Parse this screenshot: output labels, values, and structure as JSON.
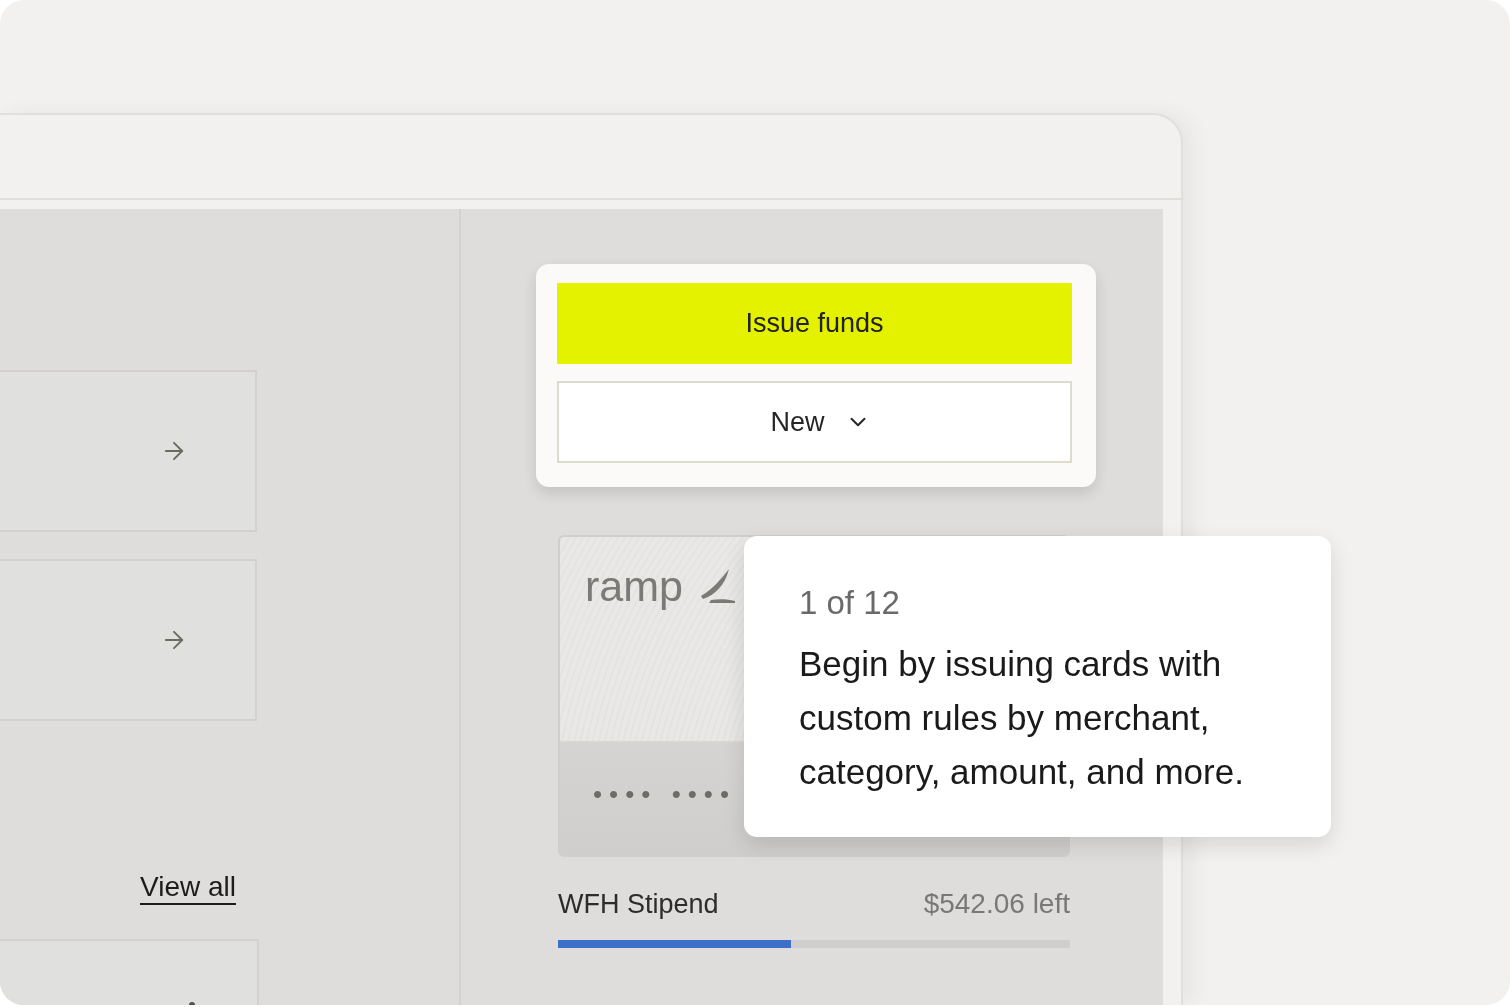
{
  "left_panel": {
    "link": "View all"
  },
  "actions": {
    "primary_button": "Issue funds",
    "dropdown_button": "New"
  },
  "card": {
    "brand": "ramp",
    "masked_number": "•••• ••••",
    "name": "WFH Stipend",
    "remaining": "$542.06 left",
    "level": 0.455
  },
  "tooltip": {
    "step": "1 of 12",
    "text": "Begin by issuing cards with custom rules by merchant, category, amount, and more."
  }
}
